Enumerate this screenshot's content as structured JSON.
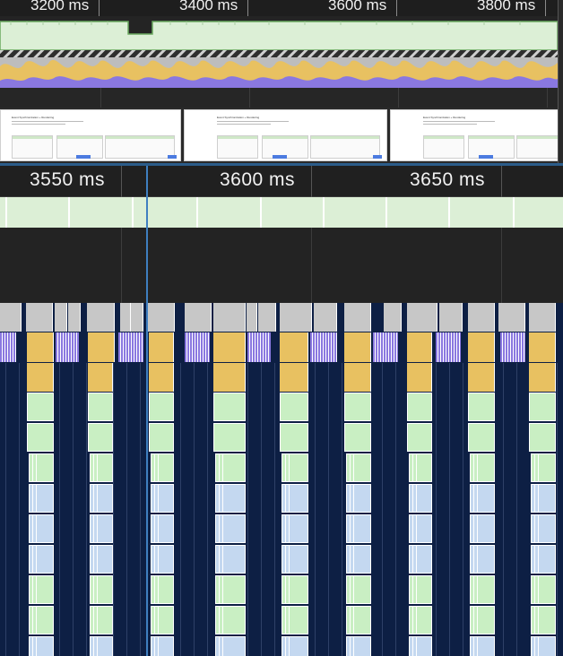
{
  "overview": {
    "ticks": [
      {
        "label": "3200 ms"
      },
      {
        "label": "3400 ms"
      },
      {
        "label": "3600 ms"
      },
      {
        "label": "3800 ms"
      }
    ]
  },
  "main_ruler": {
    "ticks": [
      {
        "label": "3550 ms"
      },
      {
        "label": "3600 ms"
      },
      {
        "label": "3650 ms"
      }
    ]
  },
  "screenshots": {
    "count": 3,
    "title_text": "Event Synchronization + Rendering"
  },
  "colors": {
    "scripting": "#e8c161",
    "rendering": "#8a78e0",
    "painting": "#c9efc3",
    "system": "#c7c7c7",
    "gpu": "#c4d8f0",
    "flame_background": "#0d1f44",
    "frames": "#dcefd6",
    "selection": "#3f7fc0"
  }
}
